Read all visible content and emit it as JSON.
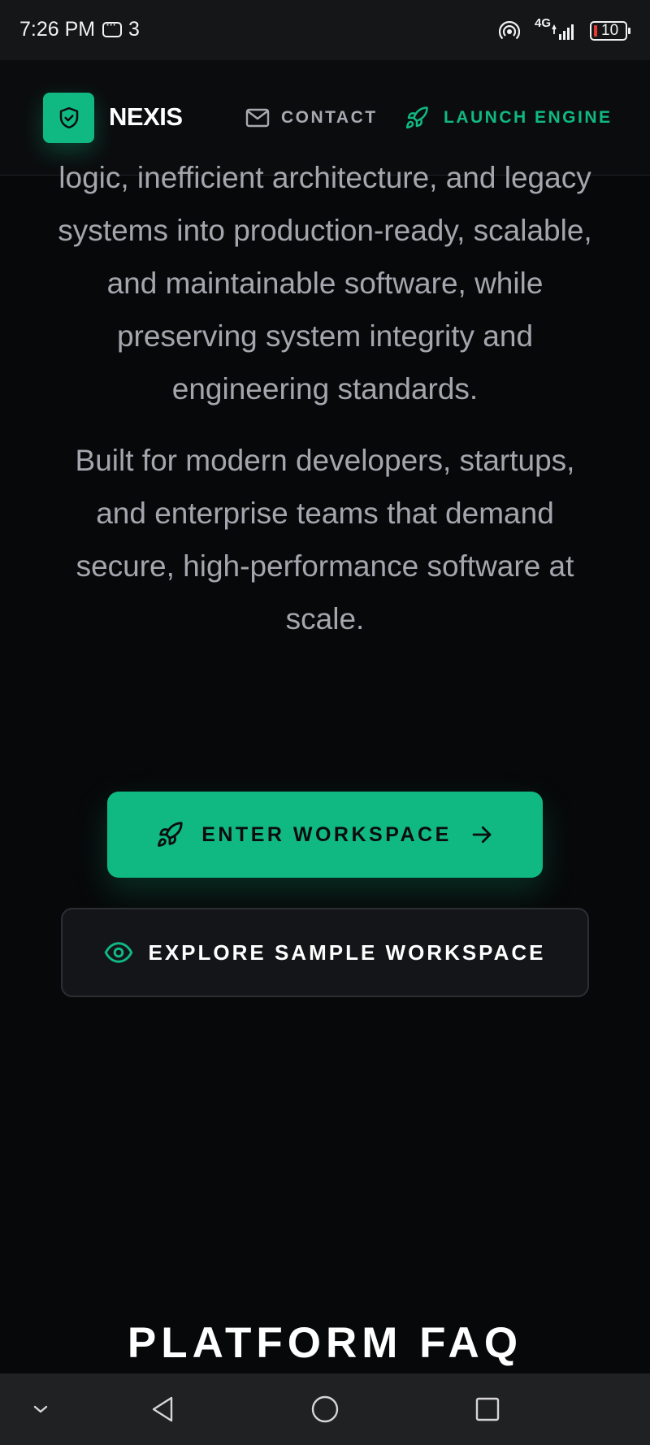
{
  "status_bar": {
    "time": "7:26 PM",
    "notification_count": "3",
    "network": "4G",
    "battery": "10"
  },
  "header": {
    "brand": "NEXIS",
    "nav": {
      "contact": "CONTACT",
      "launch": "LAUNCH ENGINE"
    }
  },
  "hero": {
    "paragraph_1": "logic, inefficient architecture, and legacy systems into production-ready, scalable, and maintainable software, while preserving system integrity and engineering standards.",
    "paragraph_2": "Built for modern developers, startups, and enterprise teams that demand secure, high-performance software at scale.",
    "primary_cta": "ENTER WORKSPACE",
    "secondary_cta": "EXPLORE SAMPLE WORKSPACE"
  },
  "faq": {
    "title": "PLATFORM FAQ"
  },
  "colors": {
    "accent": "#10b981",
    "background": "#07080a",
    "text_muted": "#a3a7ad"
  },
  "icons": {
    "logo": "shield-check-icon",
    "contact": "mail-icon",
    "launch": "rocket-icon",
    "primary_cta": "rocket-icon",
    "primary_cta_trailing": "arrow-right-icon",
    "secondary_cta": "eye-icon"
  }
}
